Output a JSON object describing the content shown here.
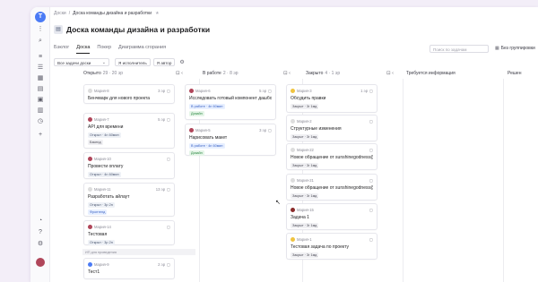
{
  "breadcrumb": {
    "root": "Доски",
    "sep": "/",
    "current": "Доска команды дизайна и разработки",
    "star": "★"
  },
  "page_title": "Доска команды дизайна и разработки",
  "tabs": [
    {
      "label": "Бэклог"
    },
    {
      "label": "Доска"
    },
    {
      "label": "Покер"
    },
    {
      "label": "Диаграмма сгорания"
    }
  ],
  "search": {
    "placeholder": "Поиск по задачам"
  },
  "grouping": {
    "label": "Без группировки",
    "icon": "grid-icon"
  },
  "filters": {
    "select_label": "Все задачи доски",
    "assignee_chip": "Я исполнитель",
    "author_chip": "Я автор",
    "settings_icon": "gear-icon"
  },
  "columns": [
    {
      "name": "Открыто",
      "count": "29 · 20 эр",
      "tools": "⊡  ‹"
    },
    {
      "name": "В работе",
      "count": "2 · 8 эр",
      "tools": "⊡  ‹"
    },
    {
      "name": "Закрыто",
      "count": "4 · 1 эр",
      "tools": "⊡  ‹"
    },
    {
      "name": "Требуется информация",
      "count": "",
      "tools": ""
    },
    {
      "name": "Решен",
      "count": "",
      "tools": ""
    }
  ],
  "colors": {
    "accent": "#4b7bf5",
    "bg": "#f3eef8",
    "blue_badge": "#3b63c4",
    "green_badge": "#2f8a45"
  },
  "cards_open": [
    {
      "key": "Мария-8",
      "meta": "3 эр",
      "title": "Бенчмарк для нового проекта",
      "badges": []
    },
    {
      "key": "Мария-7",
      "meta": "5 эр",
      "title": "API для времени",
      "badges": [
        "Открыт · 4n 60мин",
        "Бэкенд"
      ]
    },
    {
      "key": "Мария-10",
      "meta": "",
      "title": "Провести оплату",
      "badges": [
        "Открыт · 4n 60мин"
      ]
    },
    {
      "key": "Мария-11",
      "meta": "13 эр",
      "title": "Разработать айлаут",
      "badges": [
        "Открыт · 3р 2н",
        "Фронтенд"
      ]
    },
    {
      "key": "Мария-14",
      "meta": "",
      "title": "Тестовая",
      "badges": [
        "Открыт · 3р 2н"
      ]
    }
  ],
  "open_divider": "ИП для проведения",
  "open_last": {
    "key": "Мария-9",
    "meta": "2 эр",
    "title": "Тест1"
  },
  "cards_work": [
    {
      "key": "Мария-6",
      "meta": "5 эр",
      "title": "Исследовать готовый компонент дашборда",
      "badges": [
        "В работе · 4n 60мин",
        "Дизайн"
      ]
    },
    {
      "key": "Мария-5",
      "meta": "3 эр",
      "title": "Нарисовать макет",
      "badges": [
        "В работе · 4n 60мин",
        "Дизайн"
      ]
    }
  ],
  "cards_closed": [
    {
      "key": "Мария-3",
      "meta": "1 эр",
      "title": "Обсудить правки",
      "badges": [
        "Закрыт · 3r 1мд"
      ]
    },
    {
      "key": "Мария-2",
      "meta": "",
      "title": "Структурные изменения",
      "badges": [
        "Закрыт · 3r 1мд"
      ]
    },
    {
      "key": "Мария-22",
      "meta": "",
      "title": "Новое обращение от sunshinegodness@gmail.com",
      "badges": [
        "Закрыт · 3r 1мд"
      ]
    },
    {
      "key": "Мария-21",
      "meta": "",
      "title": "Новое обращение от sunshinegodness@gmail.com",
      "badges": [
        "Закрыт · 3r 1мд"
      ]
    },
    {
      "key": "Мария-15",
      "meta": "",
      "title": "Задача 1",
      "badges": [
        "Закрыт · 3r 1мд"
      ]
    },
    {
      "key": "Мария-1",
      "meta": "",
      "title": "Тестовая задача по проекту",
      "badges": [
        "Закрыт · 3r 1мд"
      ]
    }
  ]
}
